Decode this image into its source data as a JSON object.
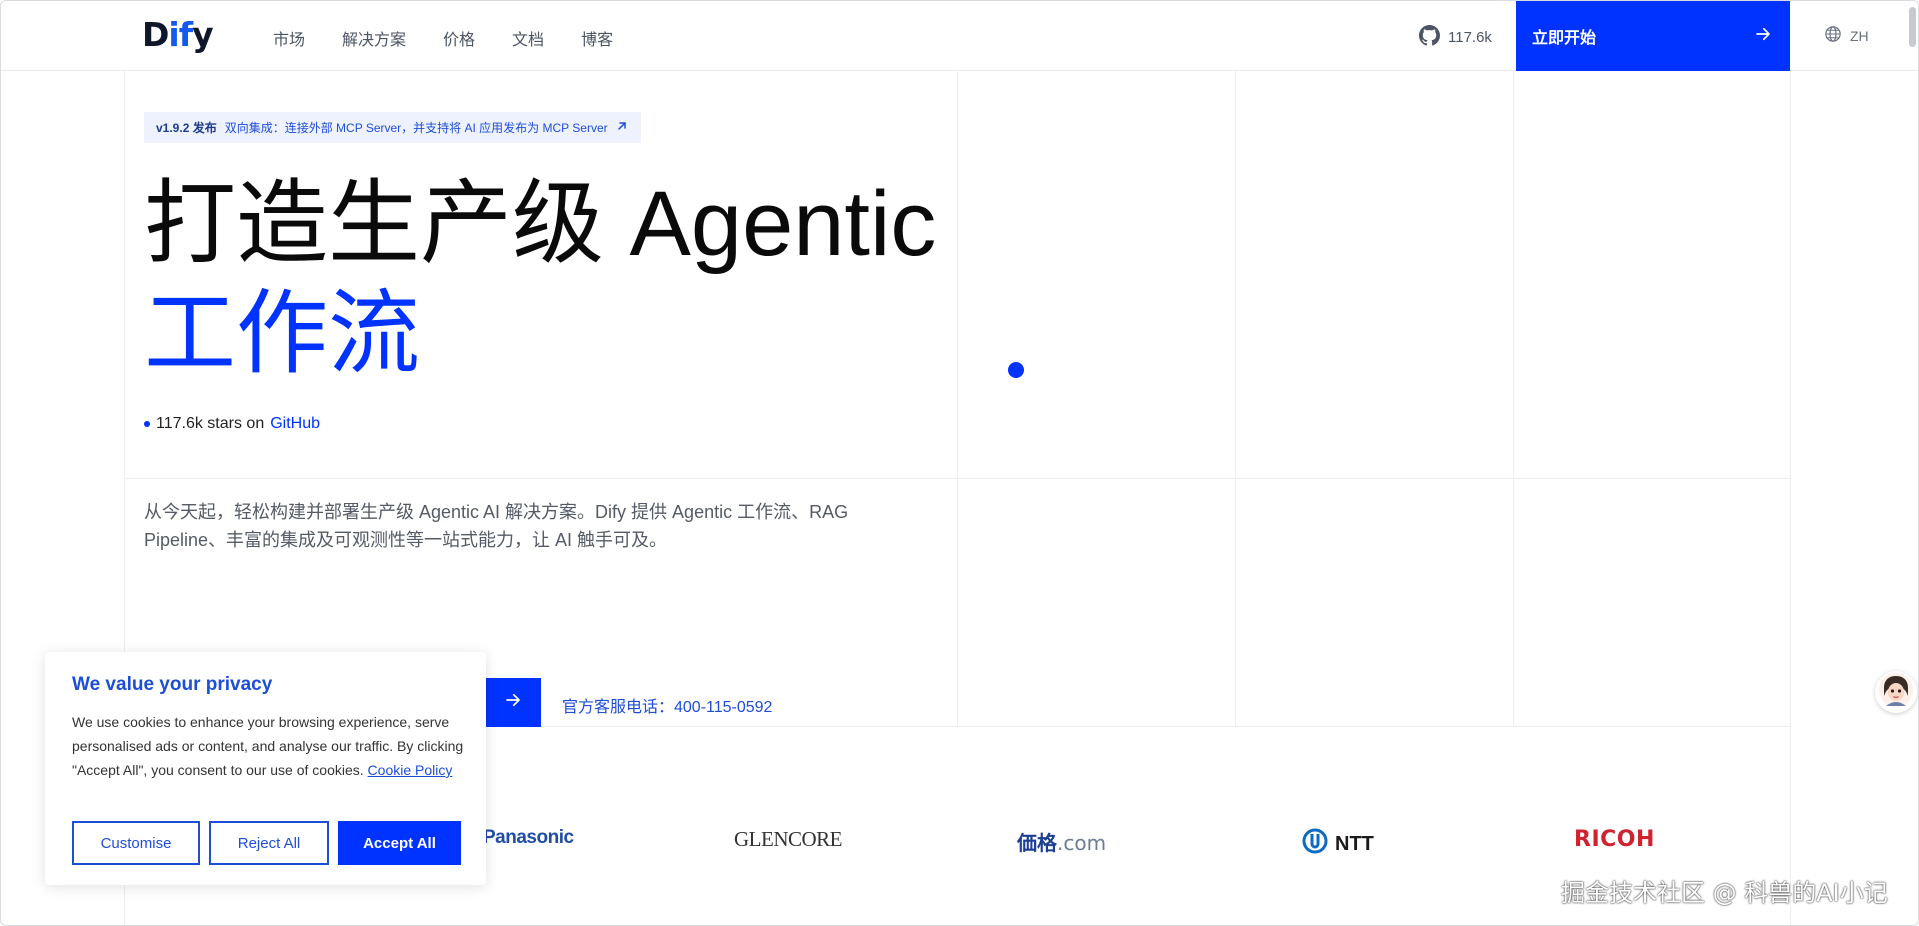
{
  "header": {
    "logo_prefix": "D",
    "logo_accent": "if",
    "logo_suffix": "y",
    "nav": [
      "市场",
      "解决方案",
      "价格",
      "文档",
      "博客"
    ],
    "github_count": "117.6k",
    "cta_label": "立即开始",
    "language": "ZH"
  },
  "hero": {
    "release_version": "v1.9.2 发布",
    "release_text": "双向集成：连接外部 MCP Server，并支持将 AI 应用发布为 MCP Server",
    "title_line1": "打造生产级 Agentic",
    "title_line2": "工作流",
    "stars_count": "117.6k stars on",
    "stars_link": "GitHub",
    "description": "从今天起，轻松构建并部署生产级 Agentic AI 解决方案。Dify 提供 Agentic 工作流、RAG Pipeline、丰富的集成及可观测性等一站式能力，让 AI 触手可及。",
    "phone": "官方客服电话：400-115-0592"
  },
  "customers": {
    "panasonic": "Panasonic",
    "glencore": "GLENCORE",
    "kakaku_main": "価格",
    "kakaku_com": ".com",
    "ntt": "NTT",
    "ricoh": "RICOH"
  },
  "cookie": {
    "title": "We value your privacy",
    "text": "We use cookies to enhance your browsing experience, serve personalised ads or content, and analyse our traffic. By clicking \"Accept All\", you consent to our use of cookies.",
    "policy_link": "Cookie Policy",
    "customise": "Customise",
    "reject": "Reject All",
    "accept": "Accept All"
  },
  "watermark": "掘金技术社区 @ 科兽的AI小记",
  "colors": {
    "brand_blue": "#0033ff",
    "link_blue": "#1d4ed8",
    "ricoh_red": "#d0232f"
  }
}
